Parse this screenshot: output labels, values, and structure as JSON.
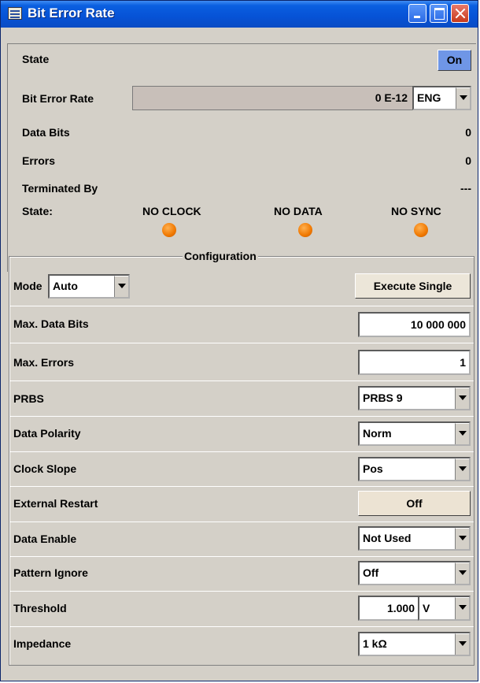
{
  "window": {
    "title": "Bit Error Rate"
  },
  "status": {
    "state_label": "State",
    "state_button": "On",
    "ber_label": "Bit Error Rate",
    "ber_value": "0 E-12",
    "ber_unit": "ENG",
    "data_bits_label": "Data Bits",
    "data_bits_value": "0",
    "errors_label": "Errors",
    "errors_value": "0",
    "terminated_label": "Terminated By",
    "terminated_value": "---",
    "state2_label": "State:",
    "indicators": [
      "NO CLOCK",
      "NO DATA",
      "NO SYNC"
    ],
    "indicator_color": "#f07800"
  },
  "config": {
    "title": "Configuration",
    "mode_label": "Mode",
    "mode_value": "Auto",
    "execute_button": "Execute Single",
    "max_data_bits_label": "Max. Data Bits",
    "max_data_bits_value": "10 000 000",
    "max_errors_label": "Max. Errors",
    "max_errors_value": "1",
    "prbs_label": "PRBS",
    "prbs_value": "PRBS 9",
    "polarity_label": "Data Polarity",
    "polarity_value": "Norm",
    "clock_slope_label": "Clock Slope",
    "clock_slope_value": "Pos",
    "ext_restart_label": "External Restart",
    "ext_restart_value": "Off",
    "data_enable_label": "Data Enable",
    "data_enable_value": "Not Used",
    "pattern_ignore_label": "Pattern Ignore",
    "pattern_ignore_value": "Off",
    "threshold_label": "Threshold",
    "threshold_value": "1.000",
    "threshold_unit": "V",
    "impedance_label": "Impedance",
    "impedance_value": "1 kΩ"
  },
  "colors": {
    "titlebar": "#0a5fe0",
    "on_button": "#6f96e6",
    "background": "#d4d0c8"
  }
}
